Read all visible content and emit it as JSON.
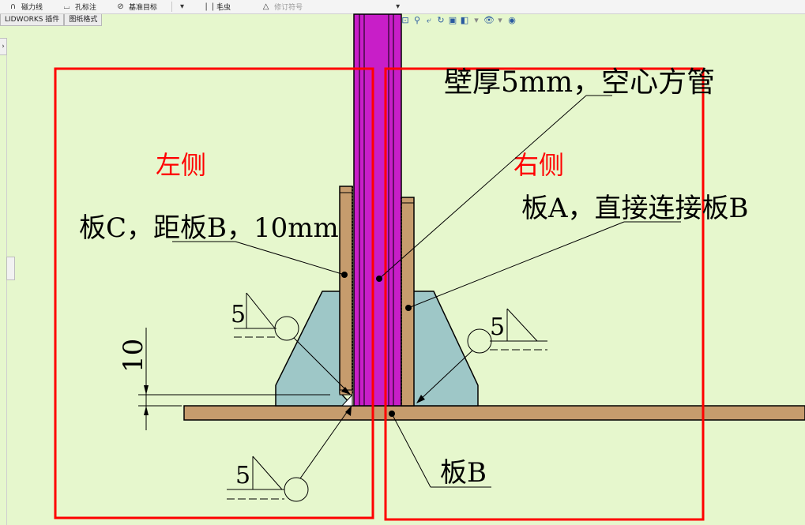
{
  "toolbar": {
    "items": [
      {
        "label": "磁力线",
        "icon": "magnet-icon"
      },
      {
        "label": "孔标注",
        "icon": "hole-callout-icon"
      },
      {
        "label": "基准目标",
        "icon": "datum-target-icon"
      },
      {
        "label": "毛虫",
        "icon": "cosmetic-thread-icon"
      },
      {
        "label": "修订符号",
        "icon": "revision-symbol-icon",
        "disabled": true
      }
    ]
  },
  "tabs": [
    "LIDWORKS 插件",
    "图纸格式"
  ],
  "annotations": {
    "left_side": "左侧",
    "right_side": "右侧",
    "tube_note": "壁厚5mm，空心方管",
    "plate_c_note": "板C，距板B，10mm",
    "plate_a_note": "板A，直接连接板B",
    "plate_b_label": "板B",
    "dimension_10": "10",
    "weld_size": "5"
  },
  "colors": {
    "background": "#e6f7cd",
    "highlight_box": "#ff0000",
    "tube": "#c81ec8",
    "plate": "#c69c6d",
    "gusset": "#9ec7c7",
    "side_label": "#ff0000"
  }
}
